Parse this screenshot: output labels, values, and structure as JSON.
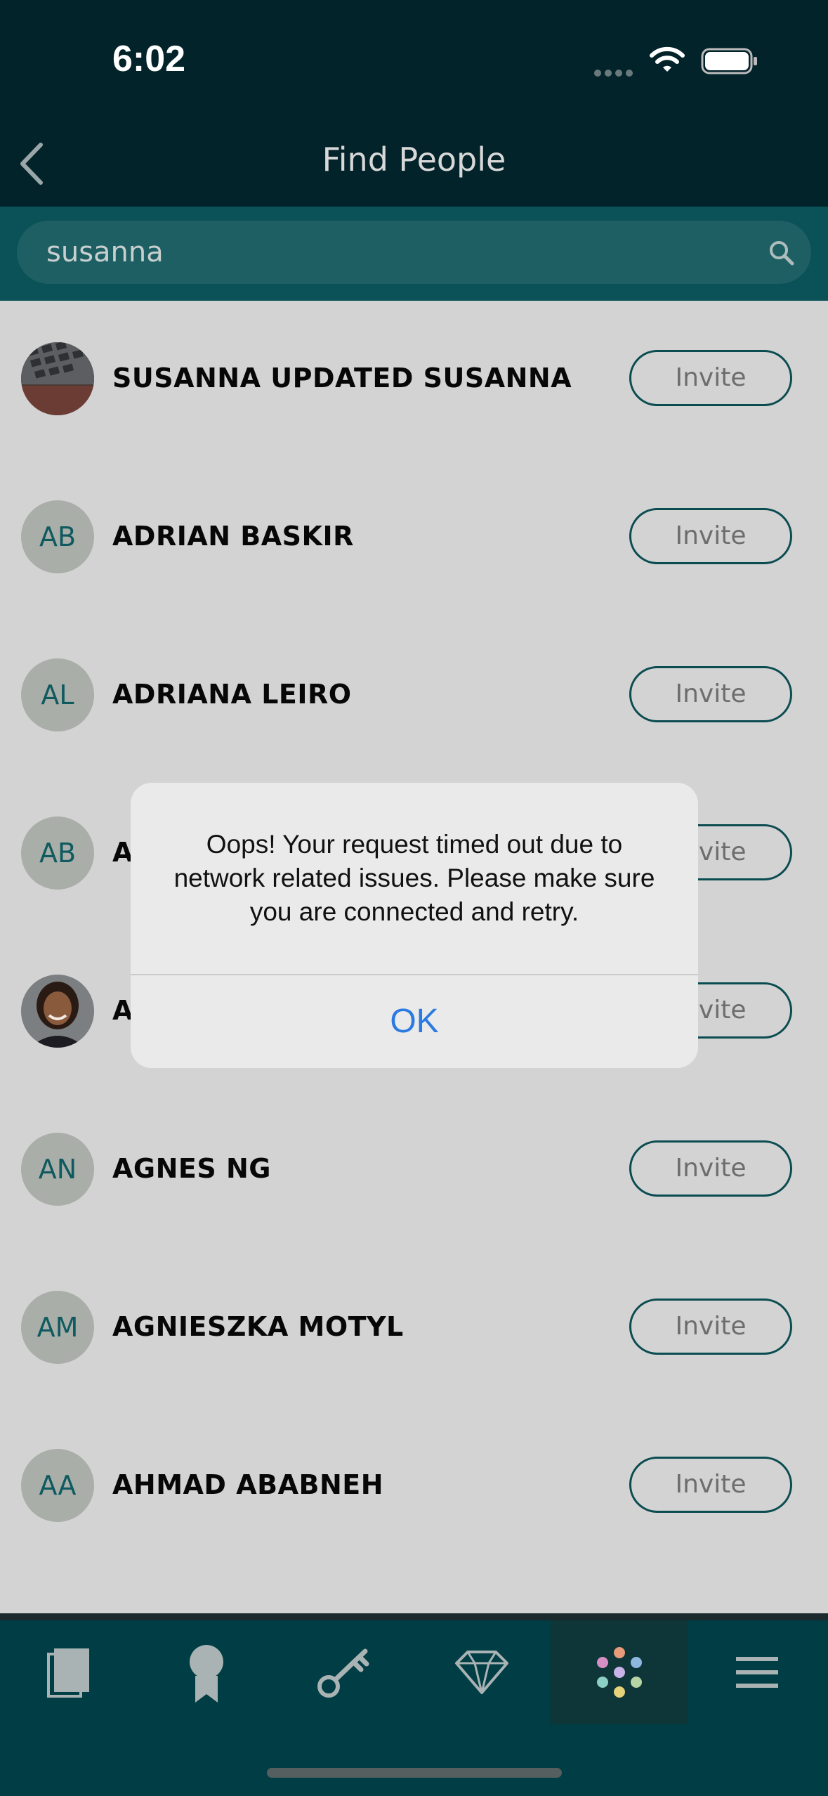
{
  "status_bar": {
    "time": "6:02"
  },
  "nav": {
    "title": "Find People"
  },
  "search": {
    "value": "susanna"
  },
  "people": [
    {
      "name": "SUSANNA UPDATED SUSANNA",
      "initials": "",
      "photo": "keyboard-photo",
      "invite_label": "Invite"
    },
    {
      "name": "ADRIAN BASKIR",
      "initials": "AB",
      "photo": "",
      "invite_label": "Invite"
    },
    {
      "name": "ADRIANA LEIRO",
      "initials": "AL",
      "photo": "",
      "invite_label": "Invite"
    },
    {
      "name": "A",
      "initials": "AB",
      "photo": "",
      "invite_label": "Invite"
    },
    {
      "name": "A",
      "initials": "",
      "photo": "person-photo",
      "invite_label": "Invite"
    },
    {
      "name": "AGNES NG",
      "initials": "AN",
      "photo": "",
      "invite_label": "Invite"
    },
    {
      "name": "AGNIESZKA MOTYL",
      "initials": "AM",
      "photo": "",
      "invite_label": "Invite"
    },
    {
      "name": "AHMAD ABABNEH",
      "initials": "AA",
      "photo": "",
      "invite_label": "Invite"
    }
  ],
  "dialog": {
    "message": "Oops! Your request timed out due to network related issues. Please make sure you are connected and retry.",
    "ok_label": "OK"
  },
  "tab_bar": {
    "tabs": [
      {
        "icon": "book-icon"
      },
      {
        "icon": "award-ribbon-icon"
      },
      {
        "icon": "key-icon"
      },
      {
        "icon": "diamond-icon"
      },
      {
        "icon": "people-dots-icon",
        "active": true
      },
      {
        "icon": "menu-icon"
      }
    ]
  }
}
